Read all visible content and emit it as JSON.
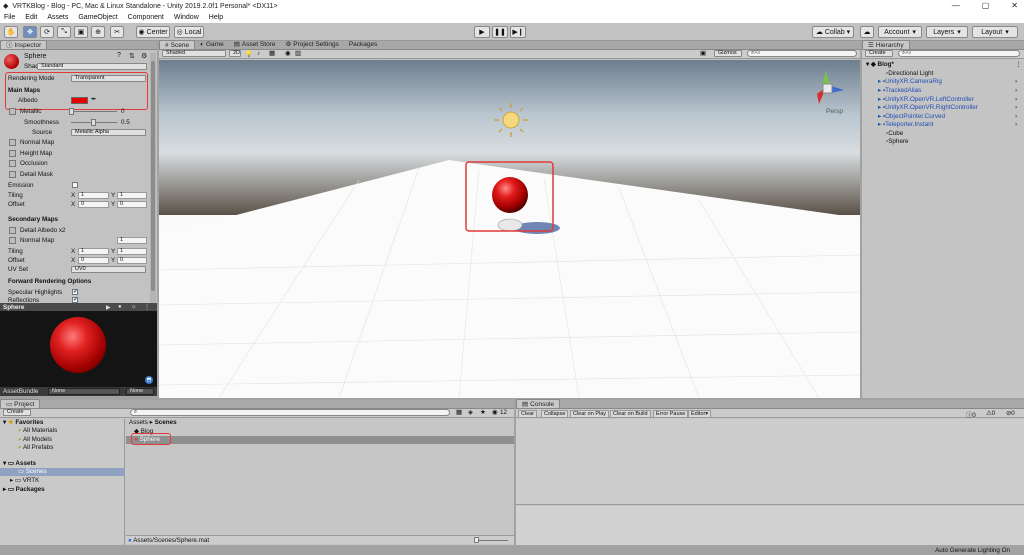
{
  "titlebar": {
    "title": "VRTKBlog - Blog - PC, Mac & Linux Standalone - Unity 2019.2.0f1 Personal* <DX11>"
  },
  "menu": [
    "File",
    "Edit",
    "Assets",
    "GameObject",
    "Component",
    "Window",
    "Help"
  ],
  "toolbar": {
    "center": "Center",
    "local": "Local",
    "collab": "Collab",
    "account": "Account",
    "layers": "Layers",
    "layout": "Layout"
  },
  "inspector": {
    "tab": "Inspector",
    "object_name": "Sphere",
    "shader_label": "Shader",
    "shader_value": "Standard",
    "rendering_mode_label": "Rendering Mode",
    "rendering_mode_value": "Transparent",
    "main_maps": "Main Maps",
    "albedo": "Albedo",
    "metallic": "Metallic",
    "metallic_value": "0",
    "smoothness": "Smoothness",
    "smoothness_value": "0.5",
    "source": "Source",
    "source_value": "Metallic Alpha",
    "normal_map": "Normal Map",
    "height_map": "Height Map",
    "occlusion": "Occlusion",
    "detail_mask": "Detail Mask",
    "emission": "Emission",
    "tiling": "Tiling",
    "offset": "Offset",
    "x": "X",
    "y": "Y",
    "tiling_x": "1",
    "tiling_y": "1",
    "offset_x": "0",
    "offset_y": "0",
    "secondary_maps": "Secondary Maps",
    "detail_albedo": "Detail Albedo x2",
    "normal_map2": "Normal Map",
    "normal_map2_value": "1",
    "tiling2_x": "1",
    "tiling2_y": "1",
    "offset2_x": "0",
    "offset2_y": "0",
    "uv_set": "UV Set",
    "uv_set_value": "UV0",
    "forward_options": "Forward Rendering Options",
    "specular_highlights": "Specular Highlights",
    "reflections": "Reflections",
    "albedo_color": "#e60000",
    "preview_title": "Sphere",
    "assetbundle_label": "AssetBundle",
    "assetbundle_value": "None",
    "assetbundle_variant": "None"
  },
  "scene": {
    "tabs": [
      "Scene",
      "Game",
      "Asset Store",
      "Project Settings",
      "Packages"
    ],
    "shading": "Shaded",
    "mode2d": "2D",
    "gizmos": "Gizmos",
    "search_placeholder": "All",
    "persp": "Persp"
  },
  "hierarchy": {
    "tab": "Hierarchy",
    "create": "Create",
    "search_placeholder": "All",
    "scene_name": "Blog*",
    "items": [
      "Directional Light",
      "UnityXR.CameraRig",
      "TrackedAlias",
      "UnityXR.OpenVR.LeftController",
      "UnityXR.OpenVR.RightController",
      "ObjectPointer.Curved",
      "Teleporter.Instant",
      "Cube",
      "Sphere"
    ]
  },
  "project": {
    "tab": "Project",
    "create": "Create",
    "count": "12",
    "favorites": "Favorites",
    "fav_items": [
      "All Materials",
      "All Models",
      "All Prefabs"
    ],
    "assets": "Assets",
    "scenes": "Scenes",
    "vrtk": "VRTK",
    "packages": "Packages",
    "breadcrumb_assets": "Assets",
    "breadcrumb_sep": "▸",
    "breadcrumb_scenes": "Scenes",
    "files": [
      "Blog",
      "Sphere"
    ],
    "path": "Assets/Scenes/Sphere.mat"
  },
  "console": {
    "tab": "Console",
    "buttons": [
      "Clear",
      "Collapse",
      "Clear on Play",
      "Clear on Build",
      "Error Pause",
      "Editor"
    ],
    "counts": [
      "0",
      "0",
      "0"
    ]
  },
  "status": {
    "text": "Auto Generate Lighting On"
  }
}
